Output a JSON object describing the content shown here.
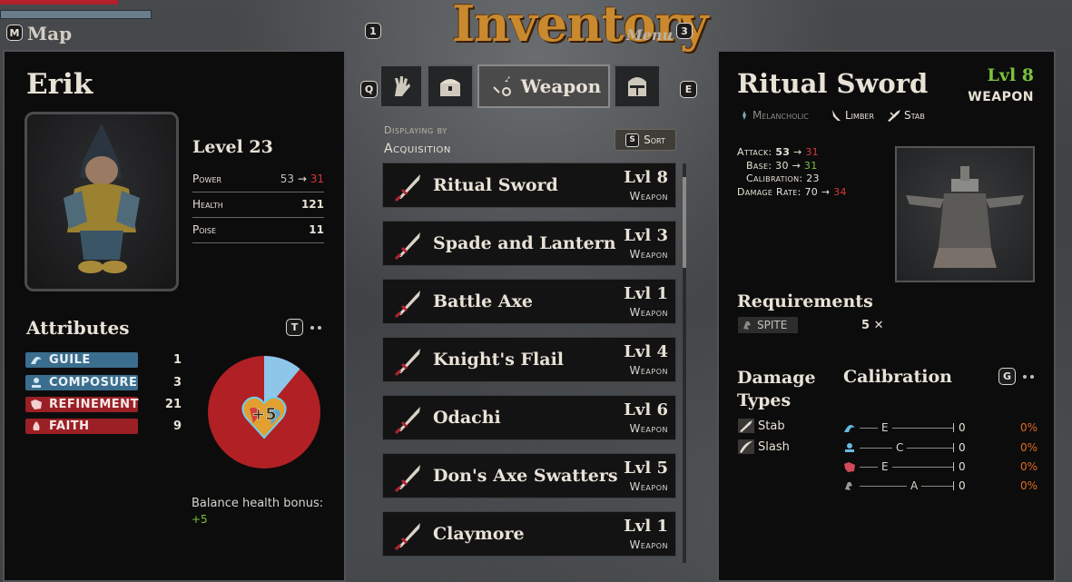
{
  "hud": {
    "map_key": "M",
    "map_label": "Map",
    "key_1": "1",
    "key_3": "3"
  },
  "header": {
    "title": "Inventory",
    "menu_label": "Menu"
  },
  "tabs": {
    "prev_key": "Q",
    "next_key": "E",
    "items": [
      {
        "icon": "hand-icon"
      },
      {
        "icon": "chest-icon"
      },
      {
        "icon": "weapon-icon",
        "label": "Weapon",
        "active": true
      },
      {
        "icon": "helmet-icon"
      }
    ]
  },
  "character": {
    "name": "Erik",
    "level_label": "Level 23",
    "stats": [
      {
        "label": "Power",
        "value": "53",
        "arrow": "→",
        "new_value": "31"
      },
      {
        "label": "Health",
        "value": "121"
      },
      {
        "label": "Poise",
        "value": "11"
      }
    ],
    "attributes_title": "Attributes",
    "attributes_key": "T",
    "attributes": [
      {
        "label": "GUILE",
        "value": "1",
        "color": "blue"
      },
      {
        "label": "COMPOSURE",
        "value": "3",
        "color": "blue"
      },
      {
        "label": "REFINEMENT",
        "value": "21",
        "color": "red"
      },
      {
        "label": "FAITH",
        "value": "9",
        "color": "red"
      }
    ],
    "balance_badge": "+5",
    "balance_label": "Balance health bonus:",
    "balance_value": "+5"
  },
  "list": {
    "sort_header": "Displaying by",
    "sort_value": "Acquisition",
    "sort_key": "S",
    "sort_label": "Sort",
    "items": [
      {
        "name": "Ritual Sword",
        "level": "Lvl 8",
        "type": "Weapon"
      },
      {
        "name": "Spade and Lantern",
        "level": "Lvl 3",
        "type": "Weapon"
      },
      {
        "name": "Battle Axe",
        "level": "Lvl 1",
        "type": "Weapon"
      },
      {
        "name": "Knight's Flail",
        "level": "Lvl 4",
        "type": "Weapon"
      },
      {
        "name": "Odachi",
        "level": "Lvl 6",
        "type": "Weapon"
      },
      {
        "name": "Don's Axe Swatters",
        "level": "Lvl 5",
        "type": "Weapon"
      },
      {
        "name": "Claymore",
        "level": "Lvl 1",
        "type": "Weapon"
      }
    ]
  },
  "detail": {
    "name": "Ritual Sword",
    "level": "Lvl 8",
    "type": "WEAPON",
    "traits": [
      {
        "label": "Melancholic",
        "dim": true
      },
      {
        "label": "Limber",
        "dim": false
      },
      {
        "label": "Stab",
        "dim": false
      }
    ],
    "attack_label": "Attack:",
    "attack_value": "53",
    "attack_new": "31",
    "base_label": "Base:",
    "base_value": "30",
    "base_new": "31",
    "calibration_label": "Calibration:",
    "calibration_value": "23",
    "damage_rate_label": "Damage Rate:",
    "damage_rate_value": "70",
    "damage_rate_new": "34",
    "arrow": "→",
    "requirements_title": "Requirements",
    "requirement_tag": "SPITE",
    "requirement_value": "5 ✕",
    "damage_types_title": "Damage Types",
    "damage_types": [
      {
        "label": "Stab"
      },
      {
        "label": "Slash"
      }
    ],
    "calibration_title": "Calibration",
    "calibration_key": "G",
    "calibration_rows": [
      {
        "grade": "E",
        "value": "0",
        "percent": "0%"
      },
      {
        "grade": "C",
        "value": "0",
        "percent": "0%"
      },
      {
        "grade": "E",
        "value": "0",
        "percent": "0%"
      },
      {
        "grade": "A",
        "value": "0",
        "percent": "0%"
      }
    ]
  },
  "pie_data": {
    "blue_fraction": 0.11,
    "red_fraction": 0.89
  },
  "colors": {
    "accent_gold": "#c9892e",
    "green": "#7cc33a",
    "red": "#d7363a",
    "orange": "#e06a20"
  }
}
